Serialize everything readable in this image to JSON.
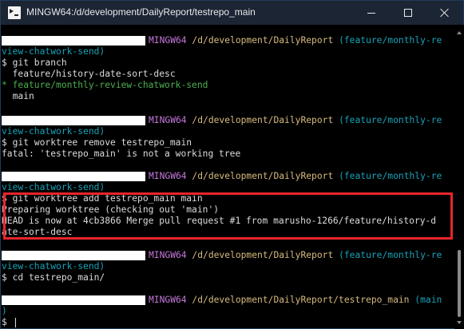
{
  "window": {
    "title": "MINGW64:/d/development/DailyReport/testrepo_main",
    "icon": "terminal-icon"
  },
  "terminal": {
    "prompt1": {
      "host": "MINGW64",
      "path": "/d/development/DailyReport",
      "branch_start": "(feature/monthly-re",
      "branch_end": "view-chatwork-send)"
    },
    "cmd1": "$ git branch",
    "branches": [
      {
        "text": "  feature/history-date-sort-desc",
        "current": false
      },
      {
        "text": "* feature/monthly-review-chatwork-send",
        "current": true
      },
      {
        "text": "  main",
        "current": false
      }
    ],
    "prompt2": {
      "host": "MINGW64",
      "path": "/d/development/DailyReport",
      "branch_start": "(feature/monthly-re",
      "branch_end": "view-chatwork-send)"
    },
    "cmd2": "$ git worktree remove testrepo_main",
    "cmd2_output": "fatal: 'testrepo_main' is not a working tree",
    "prompt3": {
      "host": "MINGW64",
      "path": "/d/development/DailyReport",
      "branch_start": "(feature/monthly-re",
      "branch_end": "view-chatwork-send)"
    },
    "cmd3": "$ git worktree add testrepo_main main",
    "cmd3_output": [
      "Preparing worktree (checking out 'main')",
      "HEAD is now at 4cb3866 Merge pull request #1 from marusho-1266/feature/history-d",
      "ate-sort-desc"
    ],
    "prompt4": {
      "host": "MINGW64",
      "path": "/d/development/DailyReport",
      "branch_start": "(feature/monthly-re",
      "branch_end": "view-chatwork-send)"
    },
    "cmd4": "$ cd testrepo_main/",
    "prompt5": {
      "host": "MINGW64",
      "path": "/d/development/DailyReport/testrepo_main",
      "branch_start": "(main",
      "branch_end": ")"
    },
    "current_input": "$ "
  },
  "colors": {
    "highlight_border": "#e8242d",
    "host": "#c678dd",
    "path": "#d7ba7d",
    "branch": "#17a2b8",
    "current_branch": "#4caf50"
  }
}
